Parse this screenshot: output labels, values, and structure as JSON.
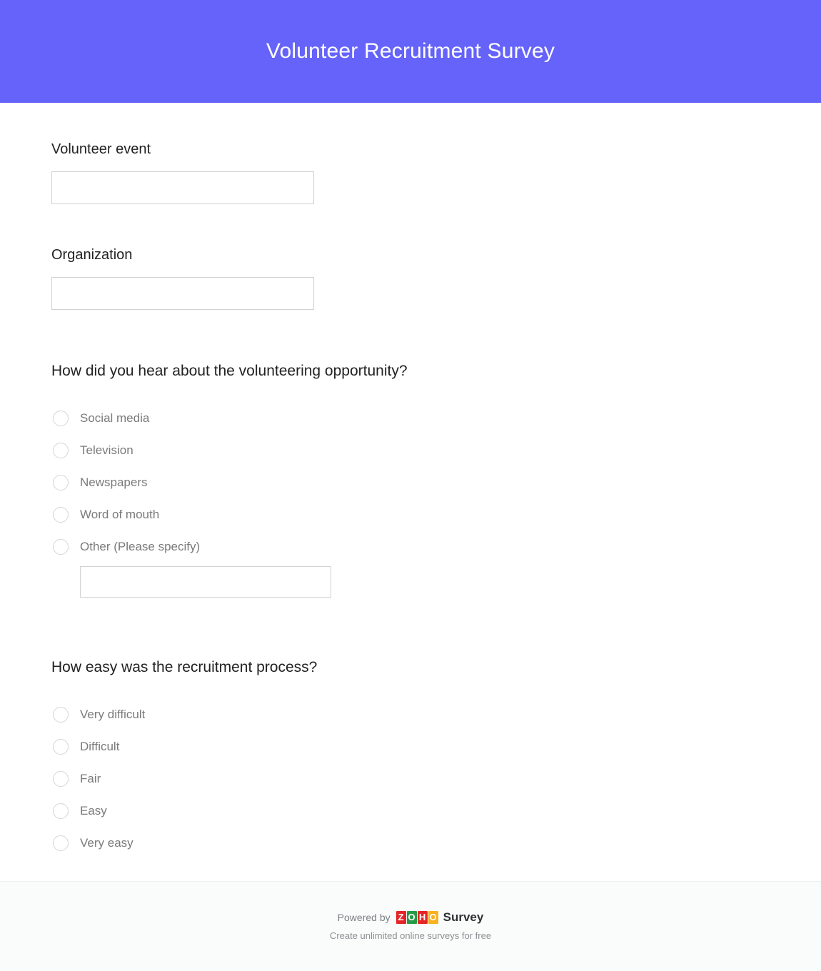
{
  "header": {
    "title": "Volunteer Recruitment Survey",
    "background_color": "#6563fa",
    "title_color": "#ffffff"
  },
  "form": {
    "fields": [
      {
        "label": "Volunteer event",
        "value": "",
        "placeholder": ""
      },
      {
        "label": "Organization",
        "value": "",
        "placeholder": ""
      }
    ],
    "questions": [
      {
        "title": "How did you hear about the volunteering opportunity?",
        "type": "radio",
        "options": [
          {
            "label": "Social media",
            "selected": false
          },
          {
            "label": "Television",
            "selected": false
          },
          {
            "label": "Newspapers",
            "selected": false
          },
          {
            "label": "Word of mouth",
            "selected": false
          },
          {
            "label": "Other (Please specify)",
            "selected": false,
            "has_text_input": true
          }
        ],
        "other_input": {
          "value": "",
          "placeholder": ""
        }
      },
      {
        "title": "How easy was the recruitment process?",
        "type": "radio",
        "options": [
          {
            "label": "Very difficult",
            "selected": false
          },
          {
            "label": "Difficult",
            "selected": false
          },
          {
            "label": "Fair",
            "selected": false
          },
          {
            "label": "Easy",
            "selected": false
          },
          {
            "label": "Very easy",
            "selected": false
          }
        ]
      }
    ]
  },
  "footer": {
    "powered_by": "Powered by",
    "brand_logo_letters": [
      "Z",
      "O",
      "H",
      "O"
    ],
    "brand_logo_colors": [
      "#e42527",
      "#279b48",
      "#e42527",
      "#f9b21d"
    ],
    "brand_product": "Survey",
    "tagline": "Create unlimited online surveys for free",
    "background_color": "#fafbfb"
  }
}
